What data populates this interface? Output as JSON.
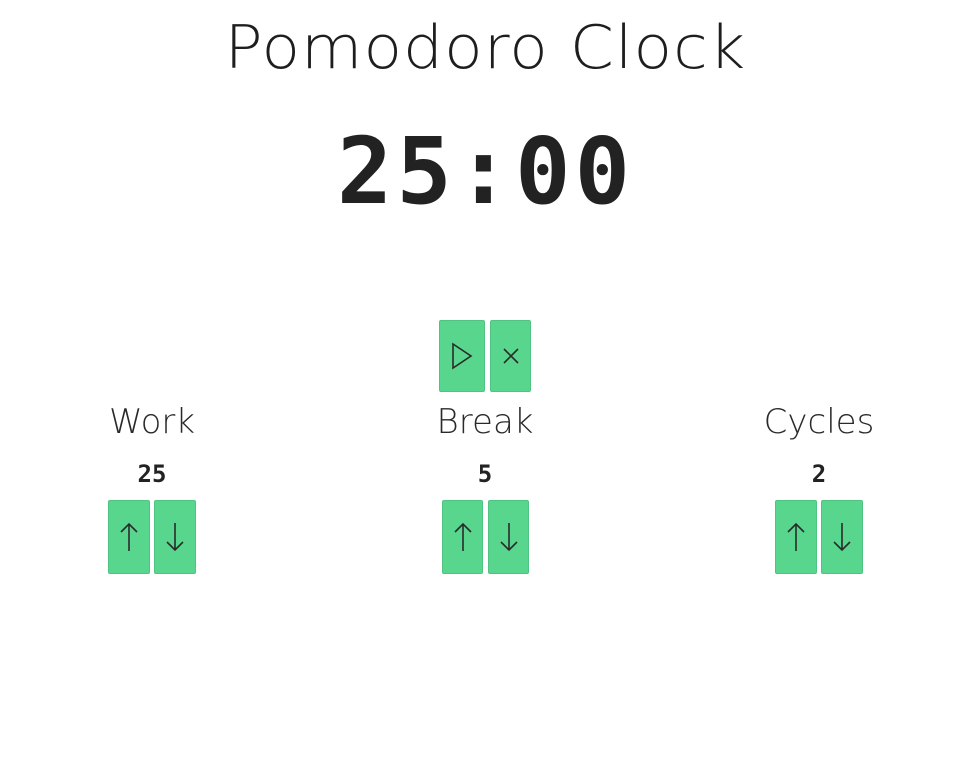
{
  "app": {
    "title": "Pomodoro Clock"
  },
  "timer": {
    "display": "25:00"
  },
  "controls": {
    "start_icon": "play-icon",
    "reset_icon": "close-icon"
  },
  "settings": [
    {
      "label": "Work",
      "value": "25",
      "up_icon": "arrow-up-icon",
      "down_icon": "arrow-down-icon"
    },
    {
      "label": "Break",
      "value": "5",
      "up_icon": "arrow-up-icon",
      "down_icon": "arrow-down-icon"
    },
    {
      "label": "Cycles",
      "value": "2",
      "up_icon": "arrow-up-icon",
      "down_icon": "arrow-down-icon"
    }
  ],
  "colors": {
    "button": "#58d68d",
    "text": "#222222",
    "background": "#ffffff"
  }
}
